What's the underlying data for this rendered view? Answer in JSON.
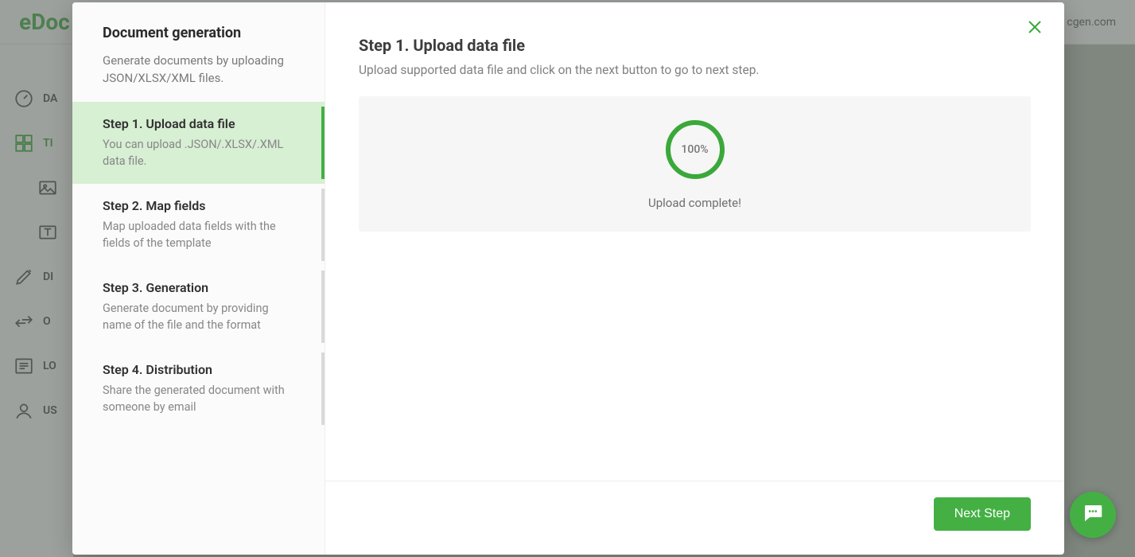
{
  "app": {
    "logo_text": "eDoc",
    "topbar_right_text": "cgen.com"
  },
  "sidebar": {
    "items": [
      {
        "label": "DA",
        "icon": "gauge"
      },
      {
        "label": "TI",
        "icon": "grid",
        "active": true
      },
      {
        "label": "",
        "icon": "image",
        "sub": true
      },
      {
        "label": "",
        "icon": "typography",
        "sub": true
      },
      {
        "label": "DI",
        "icon": "edit"
      },
      {
        "label": "O",
        "icon": "arrows"
      },
      {
        "label": "LO",
        "icon": "list"
      },
      {
        "label": "US",
        "icon": "user"
      }
    ]
  },
  "modal": {
    "header_title": "Document generation",
    "header_desc": "Generate documents by uploading JSON/XLSX/XML files.",
    "steps": [
      {
        "title": "Step 1. Upload data file",
        "desc": "You can upload .JSON/.XLSX/.XML data file.",
        "active": true
      },
      {
        "title": "Step 2. Map fields",
        "desc": "Map uploaded data fields with the fields of the template"
      },
      {
        "title": "Step 3. Generation",
        "desc": "Generate document by providing name of the file and the format"
      },
      {
        "title": "Step 4. Distribution",
        "desc": "Share the generated document with someone by email"
      }
    ],
    "main": {
      "title": "Step 1. Upload data file",
      "subtitle": "Upload supported data file and click on the next button to go to next step.",
      "progress_percent": "100%",
      "upload_status": "Upload complete!"
    },
    "footer": {
      "next_label": "Next Step"
    }
  },
  "colors": {
    "accent": "#44b044"
  }
}
